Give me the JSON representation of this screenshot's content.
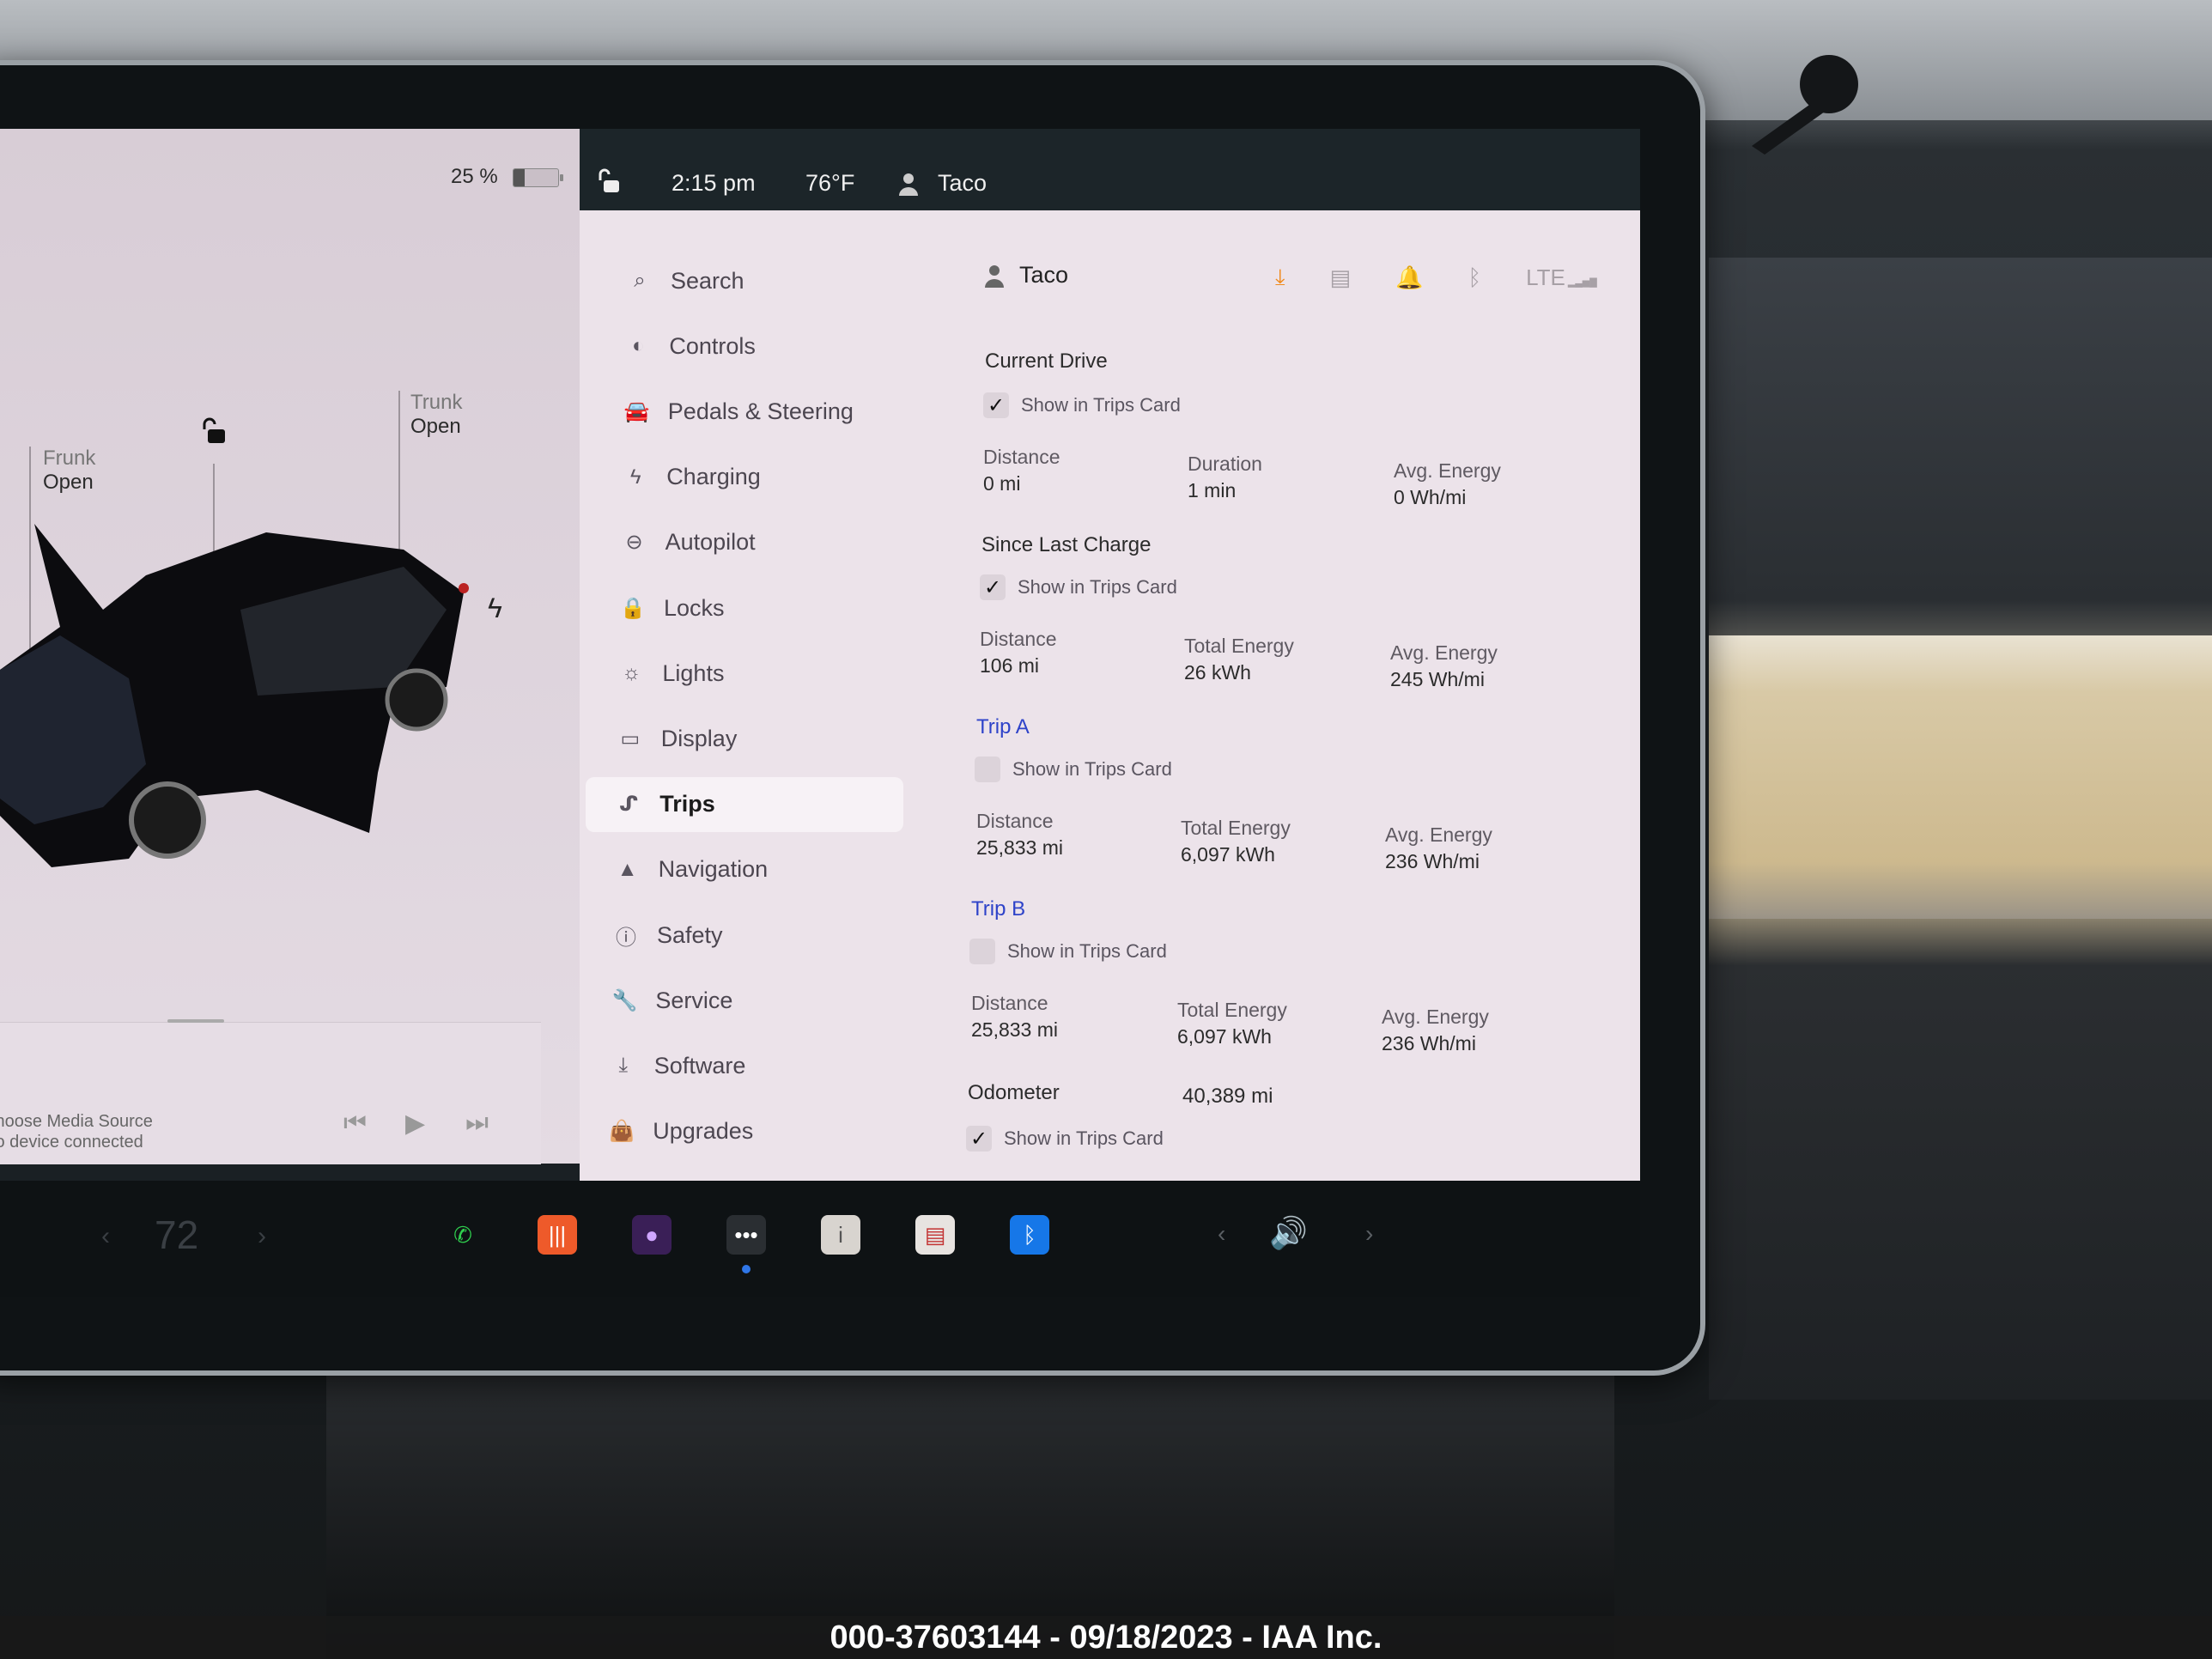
{
  "left_panel": {
    "battery_percent_label": "25 %",
    "battery_level": 0.25,
    "frunk": {
      "label": "Frunk",
      "state": "Open"
    },
    "trunk": {
      "label": "Trunk",
      "state": "Open"
    },
    "lock_state": "unlocked",
    "charge_icon": "lightning-bolt-icon"
  },
  "media": {
    "title": "Choose Media Source",
    "subtitle": "No device connected",
    "controls": [
      "previous",
      "play",
      "next"
    ]
  },
  "status_bar": {
    "time": "2:15 pm",
    "temperature": "76°F",
    "profile": "Taco",
    "download_indicator": "download-icon"
  },
  "nav": {
    "items": [
      {
        "label": "Search",
        "icon": "search-icon",
        "glyph": "⌕"
      },
      {
        "label": "Controls",
        "icon": "toggle-icon",
        "glyph": "◐"
      },
      {
        "label": "Pedals & Steering",
        "icon": "car-icon",
        "glyph": "🚘"
      },
      {
        "label": "Charging",
        "icon": "bolt-icon",
        "glyph": "ϟ"
      },
      {
        "label": "Autopilot",
        "icon": "steering-wheel-icon",
        "glyph": "⊖"
      },
      {
        "label": "Locks",
        "icon": "lock-icon",
        "glyph": "🔒"
      },
      {
        "label": "Lights",
        "icon": "light-bulb-icon",
        "glyph": "☼"
      },
      {
        "label": "Display",
        "icon": "display-icon",
        "glyph": "▭"
      },
      {
        "label": "Trips",
        "icon": "trips-icon",
        "glyph": "ᔑ",
        "active": true
      },
      {
        "label": "Navigation",
        "icon": "navigation-arrow-icon",
        "glyph": "▲"
      },
      {
        "label": "Safety",
        "icon": "alert-circle-icon",
        "glyph": "ⓘ"
      },
      {
        "label": "Service",
        "icon": "wrench-icon",
        "glyph": "🔧"
      },
      {
        "label": "Software",
        "icon": "download-icon",
        "glyph": "⤓"
      },
      {
        "label": "Upgrades",
        "icon": "shopping-bag-icon",
        "glyph": "👜"
      }
    ]
  },
  "content": {
    "profile_name": "Taco",
    "status_icons": [
      "download-icon",
      "glovebox-icon",
      "bell-icon",
      "bluetooth-icon",
      "lte-signal-icon"
    ],
    "lte_label": "LTE",
    "current_drive": {
      "title": "Current Drive",
      "show_in_trips_card": true,
      "checkbox_label": "Show in Trips Card",
      "stats": [
        {
          "label": "Distance",
          "value": "0 mi"
        },
        {
          "label": "Duration",
          "value": "1 min"
        },
        {
          "label": "Avg. Energy",
          "value": "0 Wh/mi"
        }
      ]
    },
    "since_last_charge": {
      "title": "Since Last Charge",
      "show_in_trips_card": true,
      "checkbox_label": "Show in Trips Card",
      "stats": [
        {
          "label": "Distance",
          "value": "106 mi"
        },
        {
          "label": "Total Energy",
          "value": "26 kWh"
        },
        {
          "label": "Avg. Energy",
          "value": "245 Wh/mi"
        }
      ]
    },
    "trip_a": {
      "title": "Trip A",
      "show_in_trips_card": false,
      "checkbox_label": "Show in Trips Card",
      "stats": [
        {
          "label": "Distance",
          "value": "25,833 mi"
        },
        {
          "label": "Total Energy",
          "value": "6,097 kWh"
        },
        {
          "label": "Avg. Energy",
          "value": "236 Wh/mi"
        }
      ]
    },
    "trip_b": {
      "title": "Trip B",
      "show_in_trips_card": false,
      "checkbox_label": "Show in Trips Card",
      "stats": [
        {
          "label": "Distance",
          "value": "25,833 mi"
        },
        {
          "label": "Total Energy",
          "value": "6,097 kWh"
        },
        {
          "label": "Avg. Energy",
          "value": "236 Wh/mi"
        }
      ]
    },
    "odometer": {
      "label": "Odometer",
      "value": "40,389 mi",
      "show_in_trips_card": true,
      "checkbox_label": "Show in Trips Card"
    }
  },
  "dock": {
    "cabin_temp": "72",
    "apps": [
      {
        "name": "phone",
        "glyph": "✆",
        "color": "#2fcf4e",
        "bg": "transparent"
      },
      {
        "name": "music",
        "glyph": "|||",
        "color": "#ffffff",
        "bg": "#ee5a2a"
      },
      {
        "name": "camera",
        "glyph": "●",
        "color": "#cfa5ff",
        "bg": "#3a1f57"
      },
      {
        "name": "more",
        "glyph": "•••",
        "color": "#ffffff",
        "bg": "#2a2e32"
      },
      {
        "name": "manual",
        "glyph": "i",
        "color": "#555555",
        "bg": "#d8d4cf"
      },
      {
        "name": "calendar",
        "glyph": "▤",
        "color": "#c33333",
        "bg": "#e7e3e0"
      },
      {
        "name": "bluetooth",
        "glyph": "ᛒ",
        "color": "#ffffff",
        "bg": "#1677e8"
      }
    ],
    "volume_icon": "🔊"
  },
  "watermark": "000-37603144 - 09/18/2023 - IAA Inc."
}
